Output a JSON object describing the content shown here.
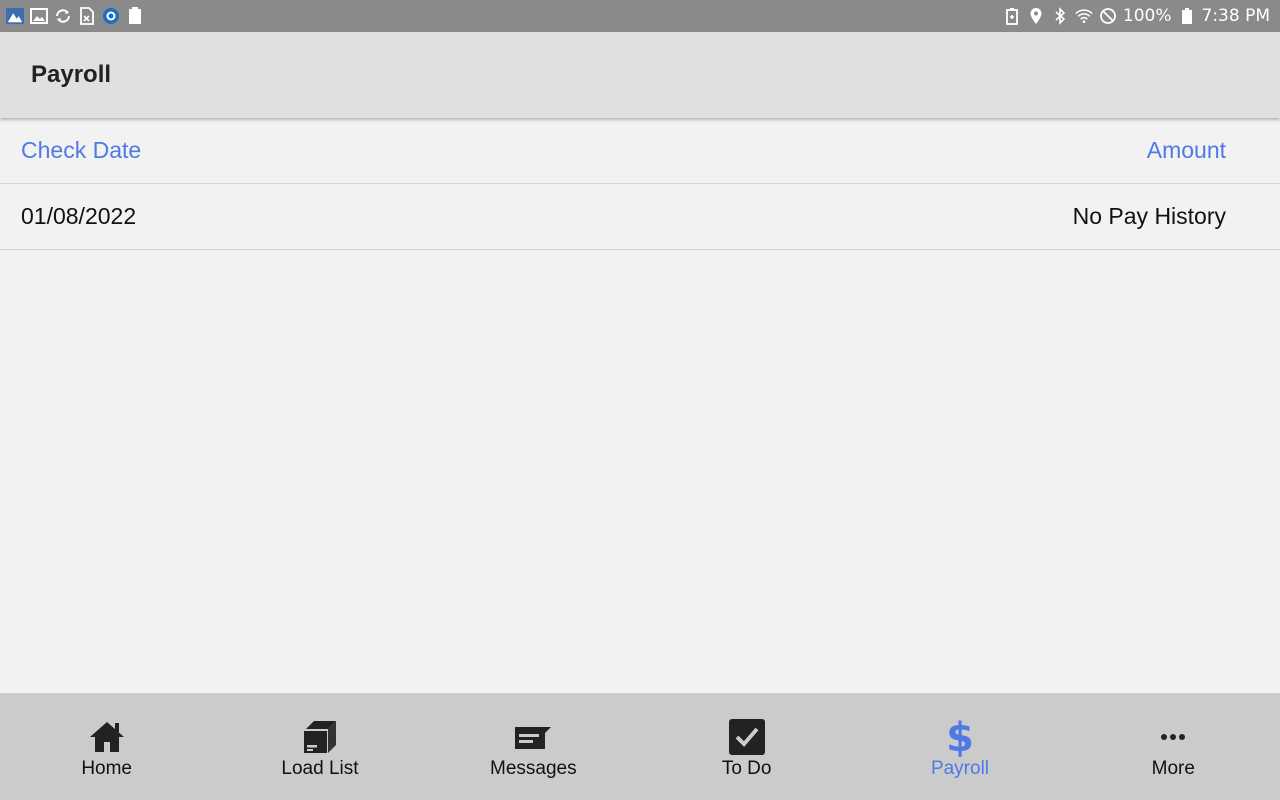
{
  "status_bar": {
    "left_icons": [
      "app-icon",
      "image-icon",
      "sync-icon",
      "sim-card-icon",
      "app-circle-icon",
      "battery-saver-icon"
    ],
    "battery": "100%",
    "time": "7:38 PM"
  },
  "header": {
    "title": "Payroll"
  },
  "table": {
    "columns": [
      "Check Date",
      "Amount"
    ],
    "rows": [
      {
        "check_date": "01/08/2022",
        "amount": "No Pay History"
      }
    ]
  },
  "bottom_nav": {
    "items": [
      {
        "label": "Home",
        "icon": "home-icon"
      },
      {
        "label": "Load List",
        "icon": "box-icon"
      },
      {
        "label": "Messages",
        "icon": "message-icon"
      },
      {
        "label": "To Do",
        "icon": "checkbox-icon"
      },
      {
        "label": "Payroll",
        "icon": "dollar-icon",
        "active": true
      },
      {
        "label": "More",
        "icon": "more-icon"
      }
    ],
    "active_color": "#4e79e6"
  }
}
